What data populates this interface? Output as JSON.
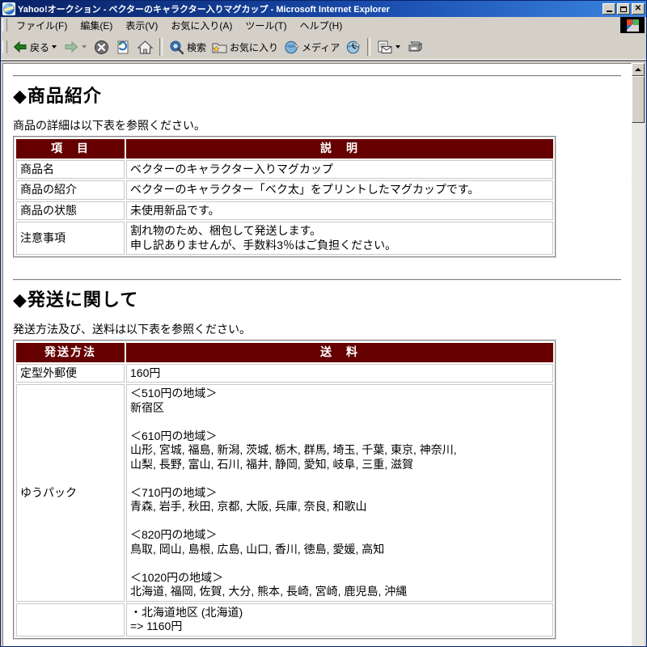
{
  "window": {
    "title": "Yahoo!オークション - ベクターのキャラクター入りマグカップ - Microsoft Internet Explorer",
    "icon": "ie-document-icon",
    "minimize_label": "",
    "maximize_label": "",
    "close_label": "✕"
  },
  "menu": {
    "items": [
      {
        "label": "ファイル(F)"
      },
      {
        "label": "編集(E)"
      },
      {
        "label": "表示(V)"
      },
      {
        "label": "お気に入り(A)"
      },
      {
        "label": "ツール(T)"
      },
      {
        "label": "ヘルプ(H)"
      }
    ]
  },
  "toolbar": {
    "back_label": "戻る",
    "forward_label": "",
    "stop_label": "",
    "refresh_label": "",
    "home_label": "",
    "search_label": "検索",
    "favorites_label": "お気に入り",
    "media_label": "メディア",
    "history_label": "",
    "mail_label": "",
    "print_label": ""
  },
  "page": {
    "section1": {
      "heading": "◆商品紹介",
      "lead": "商品の詳細は以下表を参照ください。",
      "table": {
        "headers": [
          "項　目",
          "説　明"
        ],
        "rows": [
          {
            "item": "商品名",
            "desc": "ベクターのキャラクター入りマグカップ"
          },
          {
            "item": "商品の紹介",
            "desc": "ベクターのキャラクター「ベク太」をプリントしたマグカップです。"
          },
          {
            "item": "商品の状態",
            "desc": "未使用新品です。"
          },
          {
            "item": "注意事項",
            "desc": "割れ物のため、梱包して発送します。\n申し訳ありませんが、手数料3％はご負担ください。"
          }
        ]
      }
    },
    "section2": {
      "heading": "◆発送に関して",
      "lead": "発送方法及び、送料は以下表を参照ください。",
      "table": {
        "headers": [
          "発送方法",
          "送　料"
        ],
        "rows": [
          {
            "method": "定型外郵便",
            "fee": "160円"
          },
          {
            "method": "ゆうパック",
            "fee": "＜510円の地域＞\n 新宿区\n\n＜610円の地域＞\n 山形, 宮城, 福島, 新潟, 茨城, 栃木, 群馬, 埼玉, 千葉, 東京, 神奈川,\n 山梨, 長野, 富山, 石川, 福井, 静岡, 愛知, 岐阜, 三重, 滋賀\n\n＜710円の地域＞\n 青森, 岩手, 秋田, 京都, 大阪, 兵庫, 奈良, 和歌山\n\n＜820円の地域＞\n 鳥取, 岡山, 島根, 広島, 山口, 香川, 徳島, 愛媛, 高知\n\n＜1020円の地域＞\n 北海道, 福岡, 佐賀, 大分, 熊本, 長崎, 宮崎, 鹿児島, 沖縄"
          },
          {
            "method": "",
            "fee": "・北海道地区 (北海道)\n  => 1160円"
          }
        ]
      }
    }
  },
  "colors": {
    "table_header_bg": "#660000",
    "table_header_fg": "#ffffff",
    "titlebar_start": "#0a246a",
    "titlebar_end": "#3a84e0",
    "chrome_face": "#d4d0c8"
  },
  "scrollbar": {
    "up_arrow": "▲",
    "down_arrow": "▼"
  }
}
